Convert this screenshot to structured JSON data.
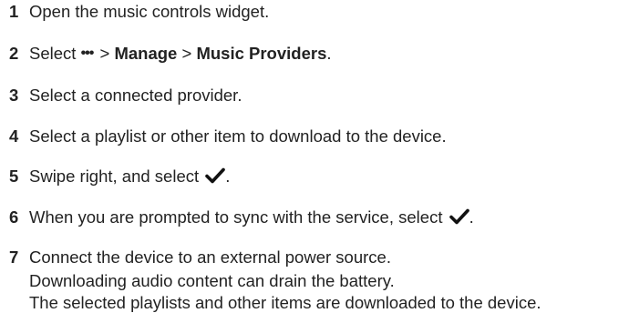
{
  "steps": [
    {
      "num": "1",
      "text": "Open the music controls widget."
    },
    {
      "num": "2",
      "prefix": "Select",
      "dots": "•••",
      "sep1": ">",
      "manage": "Manage",
      "sep2": ">",
      "providers": "Music Providers",
      "end": "."
    },
    {
      "num": "3",
      "text": "Select a connected provider."
    },
    {
      "num": "4",
      "text": "Select a playlist or other item to download to the device."
    },
    {
      "num": "5",
      "text": "Swipe right, and select",
      "icon": "checkmark-icon",
      "end": "."
    },
    {
      "num": "6",
      "text": "When you are prompted to sync with the service, select",
      "icon": "checkmark-icon",
      "end": "."
    },
    {
      "num": "7",
      "text": "Connect the device to an external power source."
    }
  ],
  "notes": {
    "battery": "Downloading audio content can drain the battery.",
    "result": "The selected playlists and other items are downloaded to the device."
  }
}
